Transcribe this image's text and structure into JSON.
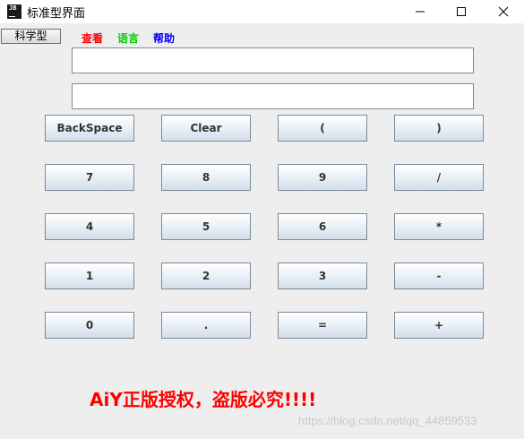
{
  "window": {
    "title": "标准型界面",
    "icon_text": "JB"
  },
  "menubar": {
    "mode_button": "科学型",
    "items": [
      {
        "label": "查看",
        "color": "#ff0000"
      },
      {
        "label": "语言",
        "color": "#00cc00"
      },
      {
        "label": "帮助",
        "color": "#0000ff"
      }
    ]
  },
  "fields": {
    "expression": "",
    "result": ""
  },
  "keys": {
    "backspace": "BackSpace",
    "clear": "Clear",
    "lparen": "(",
    "rparen": ")",
    "k7": "7",
    "k8": "8",
    "k9": "9",
    "divide": "/",
    "k4": "4",
    "k5": "5",
    "k6": "6",
    "multiply": "*",
    "k1": "1",
    "k2": "2",
    "k3": "3",
    "minus": "-",
    "k0": "0",
    "dot": ".",
    "equals": "=",
    "plus": "+"
  },
  "notice": "AiY正版授权，盗版必究!!!!",
  "watermark": "https://blog.csdn.net/qq_44859533"
}
